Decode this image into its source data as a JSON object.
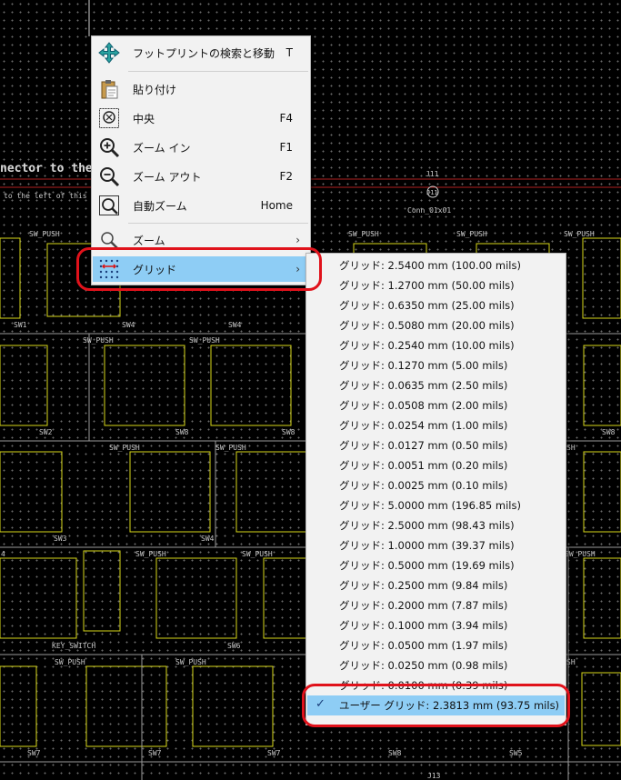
{
  "pcb": {
    "labels": {
      "big_text": "nector to the o",
      "small_text": "to the left of this U",
      "j11": "J11",
      "j11_mark": "J11",
      "conn": "Conn_01x01",
      "j13": "J13",
      "sw_push": "SW_PUSH",
      "key_switch": "KEY_SWITCH",
      "sw1": "SW1",
      "sw2": "SW2",
      "sw3": "SW3",
      "sw4": "SW4",
      "sw5": "SW5",
      "sw6": "SW6",
      "sw7": "SW7",
      "sw8": "SW8",
      "sh": "SH",
      "n4": "4"
    },
    "colors": {
      "outline": "#d8d81a",
      "text": "#c9c9c9",
      "background": "#000000"
    }
  },
  "context_menu": {
    "items": [
      {
        "label": "フットプリントの検索と移動",
        "shortcut": "T",
        "icon": "move-cross-icon"
      },
      {
        "label": "貼り付け",
        "shortcut": "",
        "icon": "clipboard-paste-icon"
      },
      {
        "label": "中央",
        "shortcut": "F4",
        "icon": "zoom-center-icon"
      },
      {
        "label": "ズーム イン",
        "shortcut": "F1",
        "icon": "zoom-in-icon"
      },
      {
        "label": "ズーム アウト",
        "shortcut": "F2",
        "icon": "zoom-out-icon"
      },
      {
        "label": "自動ズーム",
        "shortcut": "Home",
        "icon": "zoom-fit-icon"
      },
      {
        "label": "ズーム",
        "arrow": "›",
        "icon": "zoom-submenu-icon"
      },
      {
        "label": "グリッド",
        "arrow": "›",
        "icon": "grid-icon"
      }
    ]
  },
  "grid_submenu": {
    "items": [
      "グリッド: 2.5400 mm (100.00 mils)",
      "グリッド: 1.2700 mm (50.00 mils)",
      "グリッド: 0.6350 mm (25.00 mils)",
      "グリッド: 0.5080 mm (20.00 mils)",
      "グリッド: 0.2540 mm (10.00 mils)",
      "グリッド: 0.1270 mm (5.00 mils)",
      "グリッド: 0.0635 mm (2.50 mils)",
      "グリッド: 0.0508 mm (2.00 mils)",
      "グリッド: 0.0254 mm (1.00 mils)",
      "グリッド: 0.0127 mm (0.50 mils)",
      "グリッド: 0.0051 mm (0.20 mils)",
      "グリッド: 0.0025 mm (0.10 mils)",
      "グリッド: 5.0000 mm (196.85 mils)",
      "グリッド: 2.5000 mm (98.43 mils)",
      "グリッド: 1.0000 mm (39.37 mils)",
      "グリッド: 0.5000 mm (19.69 mils)",
      "グリッド: 0.2500 mm (9.84 mils)",
      "グリッド: 0.2000 mm (7.87 mils)",
      "グリッド: 0.1000 mm (3.94 mils)",
      "グリッド: 0.0500 mm (1.97 mils)",
      "グリッド: 0.0250 mm (0.98 mils)",
      "グリッド: 0.0100 mm (0.39 mils)"
    ],
    "selected": {
      "label": "ユーザー グリッド: 2.3813 mm (93.75 mils)",
      "check": "✓"
    }
  },
  "annotation_color": "#e0121b"
}
